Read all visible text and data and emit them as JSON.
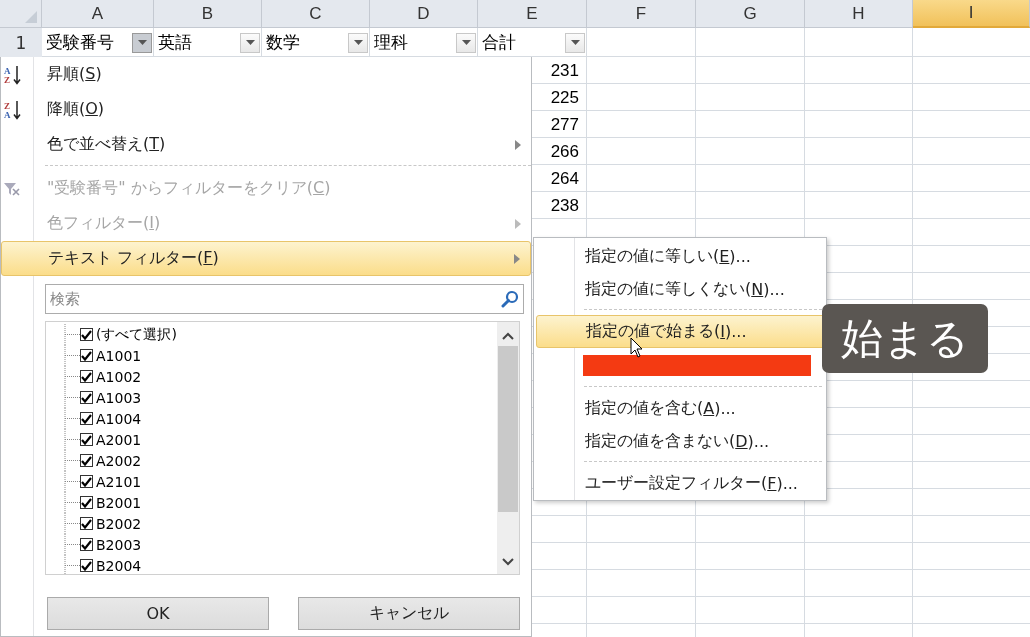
{
  "sheet": {
    "columns": [
      {
        "label": "A",
        "selected": false
      },
      {
        "label": "B",
        "selected": false
      },
      {
        "label": "C",
        "selected": false
      },
      {
        "label": "D",
        "selected": false
      },
      {
        "label": "E",
        "selected": false
      },
      {
        "label": "F",
        "selected": false
      },
      {
        "label": "G",
        "selected": false
      },
      {
        "label": "H",
        "selected": false
      },
      {
        "label": "I",
        "selected": true
      }
    ],
    "header_row": {
      "row_number": "1",
      "cells": [
        {
          "text": "受験番号",
          "open": true
        },
        {
          "text": "英語",
          "open": false
        },
        {
          "text": "数学",
          "open": false
        },
        {
          "text": "理科",
          "open": false
        },
        {
          "text": "合計",
          "open": false
        }
      ]
    },
    "total_column": [
      "231",
      "225",
      "277",
      "266",
      "264",
      "238"
    ]
  },
  "filter_menu": {
    "items": [
      {
        "kind": "sort",
        "icon_letters": [
          "A",
          "Z"
        ],
        "label_parts": [
          "昇順(",
          "S",
          ")"
        ],
        "disabled": false,
        "submenu": false,
        "selected": false
      },
      {
        "kind": "sort",
        "icon_letters": [
          "Z",
          "A"
        ],
        "label_parts": [
          "降順(",
          "O",
          ")"
        ],
        "disabled": false,
        "submenu": false,
        "selected": false
      },
      {
        "kind": "item",
        "label_parts": [
          "色で並べ替え(",
          "T",
          ")"
        ],
        "disabled": false,
        "submenu": true,
        "selected": false
      },
      {
        "kind": "separator"
      },
      {
        "kind": "clear",
        "label_parts": [
          "\"受験番号\" からフィルターをクリア(",
          "C",
          ")"
        ],
        "disabled": true,
        "submenu": false,
        "selected": false
      },
      {
        "kind": "item",
        "label_parts": [
          "色フィルター(",
          "I",
          ")"
        ],
        "disabled": true,
        "submenu": true,
        "selected": false
      },
      {
        "kind": "item",
        "label_parts": [
          "テキスト フィルター(",
          "F",
          ")"
        ],
        "disabled": false,
        "submenu": true,
        "selected": true
      }
    ],
    "search": {
      "placeholder": "検索"
    },
    "values": [
      {
        "label": "(すべて選択)",
        "checked": true
      },
      {
        "label": "A1001",
        "checked": true
      },
      {
        "label": "A1002",
        "checked": true
      },
      {
        "label": "A1003",
        "checked": true
      },
      {
        "label": "A1004",
        "checked": true
      },
      {
        "label": "A2001",
        "checked": true
      },
      {
        "label": "A2002",
        "checked": true
      },
      {
        "label": "A2101",
        "checked": true
      },
      {
        "label": "B2001",
        "checked": true
      },
      {
        "label": "B2002",
        "checked": true
      },
      {
        "label": "B2003",
        "checked": true
      },
      {
        "label": "B2004",
        "checked": true
      }
    ],
    "buttons": [
      "OK",
      "キャンセル"
    ]
  },
  "text_filter_submenu": {
    "items": [
      {
        "kind": "item",
        "label_parts": [
          "指定の値に等しい(",
          "E",
          ")..."
        ],
        "selected": false
      },
      {
        "kind": "item",
        "label_parts": [
          "指定の値に等しくない(",
          "N",
          ")..."
        ],
        "selected": false
      },
      {
        "kind": "separator"
      },
      {
        "kind": "item",
        "label_parts": [
          "指定の値で始まる(",
          "I",
          ")..."
        ],
        "selected": true
      },
      {
        "kind": "redacted"
      },
      {
        "kind": "separator"
      },
      {
        "kind": "item",
        "label_parts": [
          "指定の値を含む(",
          "A",
          ")..."
        ],
        "selected": false
      },
      {
        "kind": "item",
        "label_parts": [
          "指定の値を含まない(",
          "D",
          ")..."
        ],
        "selected": false
      },
      {
        "kind": "separator"
      },
      {
        "kind": "item",
        "label_parts": [
          "ユーザー設定フィルター(",
          "F",
          ")..."
        ],
        "selected": false
      }
    ]
  },
  "caption": "始まる"
}
